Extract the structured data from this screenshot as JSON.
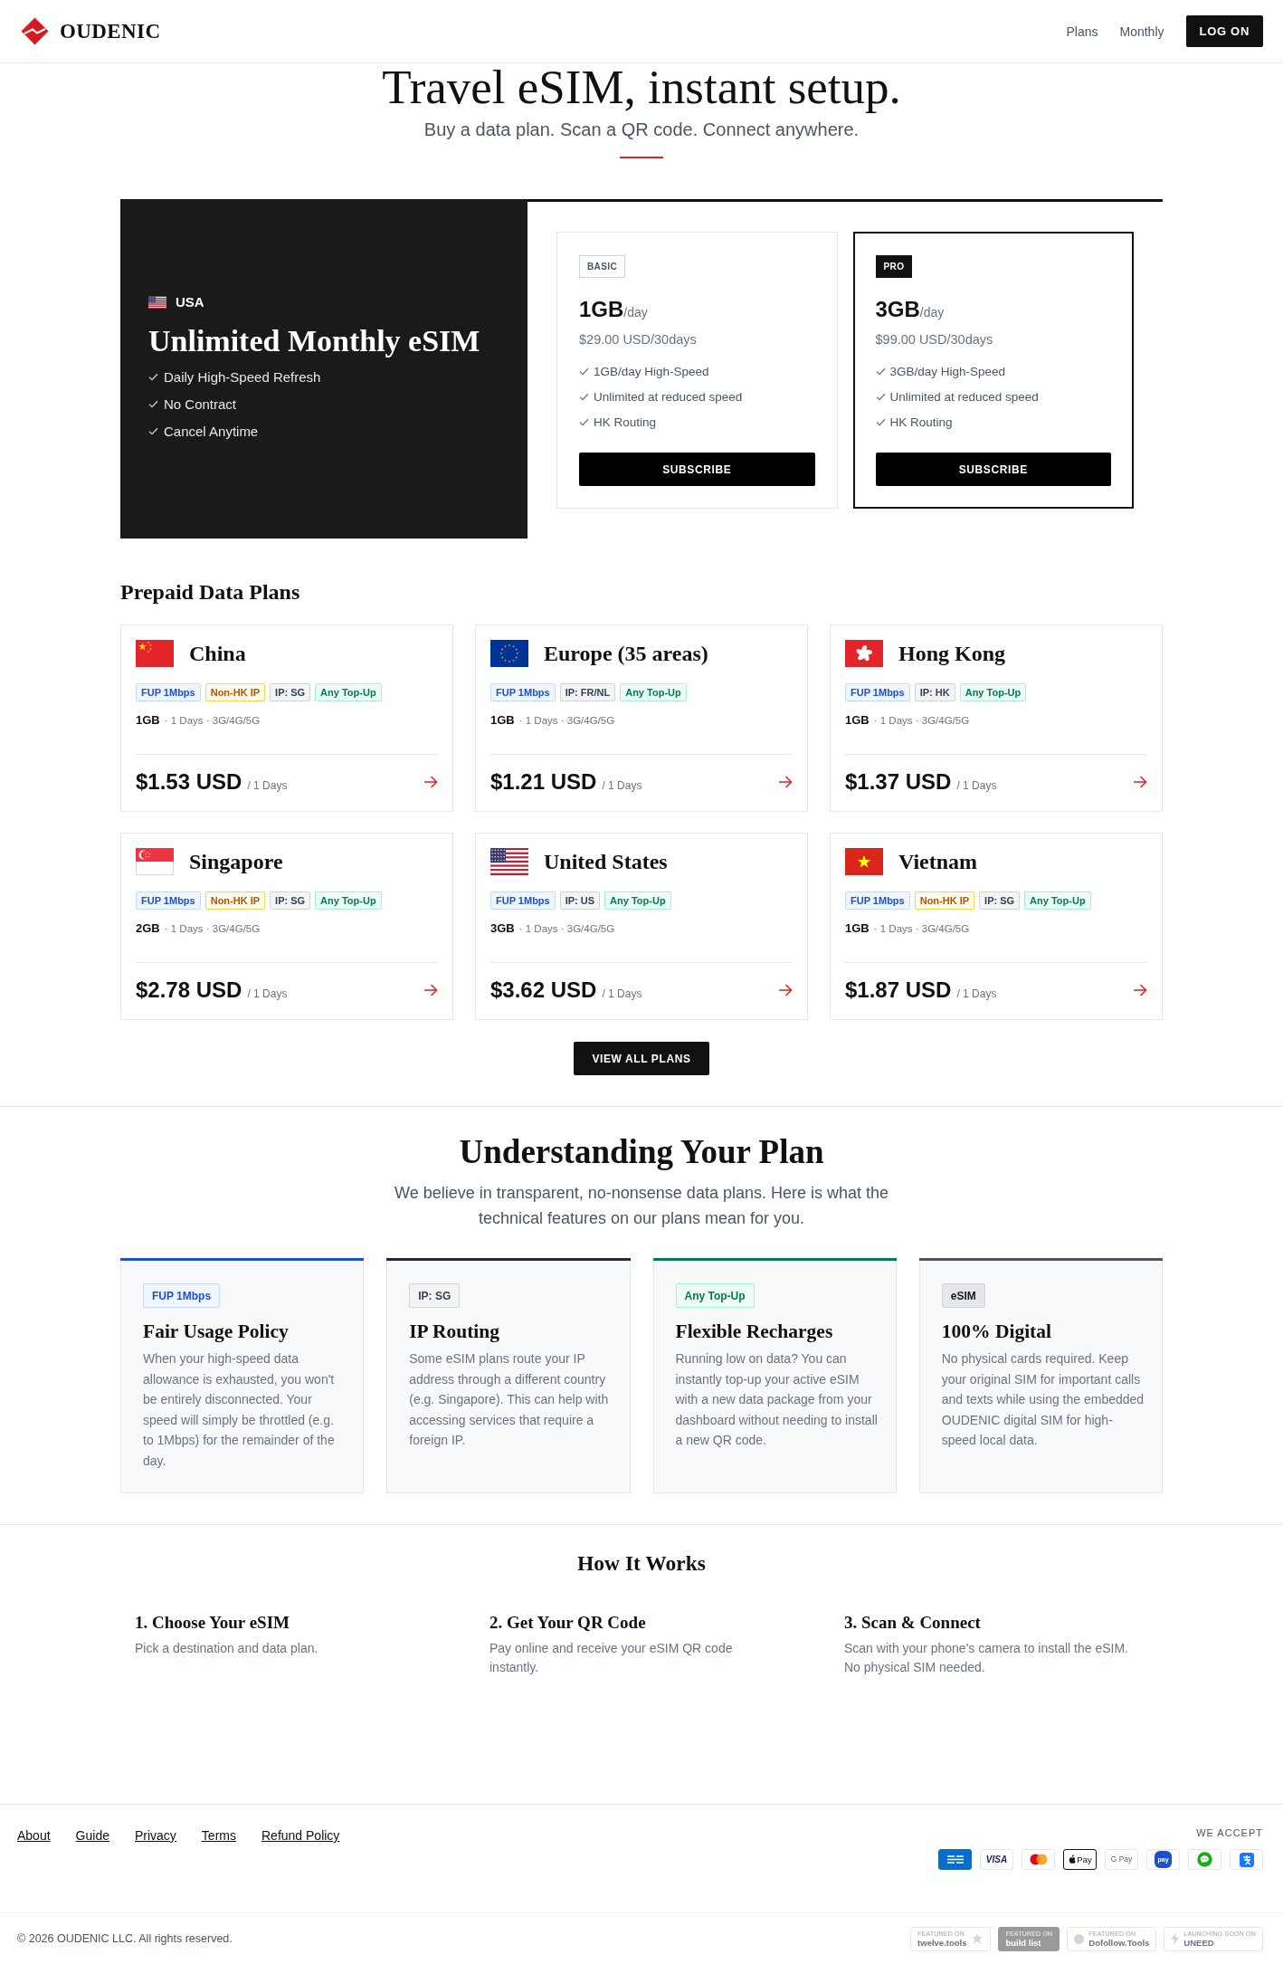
{
  "header": {
    "brand": "OUDENIC",
    "nav": [
      {
        "label": "Plans"
      },
      {
        "label": "Monthly"
      }
    ],
    "login": "LOG ON"
  },
  "hero": {
    "title": "Travel eSIM, instant setup.",
    "subtitle": "Buy a data plan. Scan a QR code. Connect anywhere."
  },
  "monthly": {
    "country": {
      "kind": "us",
      "name": "USA"
    },
    "title": "Unlimited Monthly eSIM",
    "perks": [
      "Daily High-Speed Refresh",
      "No Contract",
      "Cancel Anytime"
    ],
    "plans": [
      {
        "badge": "BASIC",
        "featured": false,
        "amount": "1GB",
        "unit": "/day",
        "price": "$29.00 USD/30days",
        "features": [
          "1GB/day High-Speed",
          "Unlimited at reduced speed",
          "HK Routing"
        ],
        "button": "SUBSCRIBE"
      },
      {
        "badge": "PRO",
        "featured": true,
        "amount": "3GB",
        "unit": "/day",
        "price": "$99.00 USD/30days",
        "features": [
          "3GB/day High-Speed",
          "Unlimited at reduced speed",
          "HK Routing"
        ],
        "button": "SUBSCRIBE"
      }
    ]
  },
  "prepaid": {
    "title": "Prepaid Data Plans",
    "plans": [
      {
        "kind": "cn",
        "name": "China",
        "tags": [
          {
            "kind": "speed",
            "label": "FUP 1Mbps"
          },
          {
            "kind": "region",
            "label": "Non-HK IP"
          },
          {
            "kind": "ip",
            "label": "IP: SG"
          },
          {
            "kind": "topup",
            "label": "Any Top-Up"
          }
        ],
        "data": "1GB",
        "meta": "· 1 Days · 3G/4G/5G",
        "price": "$1.53 USD",
        "period": "/ 1 Days"
      },
      {
        "kind": "eu",
        "name": "Europe (35 areas)",
        "tags": [
          {
            "kind": "speed",
            "label": "FUP 1Mbps"
          },
          {
            "kind": "ip",
            "label": "IP: FR/NL"
          },
          {
            "kind": "topup",
            "label": "Any Top-Up"
          }
        ],
        "data": "1GB",
        "meta": "· 1 Days · 3G/4G/5G",
        "price": "$1.21 USD",
        "period": "/ 1 Days"
      },
      {
        "kind": "hk",
        "name": "Hong Kong",
        "tags": [
          {
            "kind": "speed",
            "label": "FUP 1Mbps"
          },
          {
            "kind": "ip",
            "label": "IP: HK"
          },
          {
            "kind": "topup",
            "label": "Any Top-Up"
          }
        ],
        "data": "1GB",
        "meta": "· 1 Days · 3G/4G/5G",
        "price": "$1.37 USD",
        "period": "/ 1 Days"
      },
      {
        "kind": "sg",
        "name": "Singapore",
        "tags": [
          {
            "kind": "speed",
            "label": "FUP 1Mbps"
          },
          {
            "kind": "region",
            "label": "Non-HK IP"
          },
          {
            "kind": "ip",
            "label": "IP: SG"
          },
          {
            "kind": "topup",
            "label": "Any Top-Up"
          }
        ],
        "data": "2GB",
        "meta": "· 1 Days · 3G/4G/5G",
        "price": "$2.78 USD",
        "period": "/ 1 Days"
      },
      {
        "kind": "us",
        "name": "United States",
        "tags": [
          {
            "kind": "speed",
            "label": "FUP 1Mbps"
          },
          {
            "kind": "ip",
            "label": "IP: US"
          },
          {
            "kind": "topup",
            "label": "Any Top-Up"
          }
        ],
        "data": "3GB",
        "meta": "· 1 Days · 3G/4G/5G",
        "price": "$3.62 USD",
        "period": "/ 1 Days"
      },
      {
        "kind": "vn",
        "name": "Vietnam",
        "tags": [
          {
            "kind": "speed",
            "label": "FUP 1Mbps"
          },
          {
            "kind": "region",
            "label": "Non-HK IP"
          },
          {
            "kind": "ip",
            "label": "IP: SG"
          },
          {
            "kind": "topup",
            "label": "Any Top-Up"
          }
        ],
        "data": "1GB",
        "meta": "· 1 Days · 3G/4G/5G",
        "price": "$1.87 USD",
        "period": "/ 1 Days"
      }
    ],
    "button": "VIEW ALL PLANS"
  },
  "understanding": {
    "title": "Understanding Your Plan",
    "subtitle": "We believe in transparent, no-nonsense data plans. Here is what the technical features on our plans mean for you.",
    "cards": [
      {
        "color": "#1d4ed8",
        "tag": {
          "kind": "speed",
          "label": "FUP 1Mbps"
        },
        "title": "Fair Usage Policy",
        "text": "When your high-speed data allowance is exhausted, you won't be entirely disconnected. Your speed will simply be throttled (e.g. to 1Mbps) for the remainder of the day."
      },
      {
        "color": "#1f2937",
        "tag": {
          "kind": "ip",
          "label": "IP: SG"
        },
        "title": "IP Routing",
        "text": "Some eSIM plans route your IP address through a different country (e.g. Singapore). This can help with accessing services that require a foreign IP."
      },
      {
        "color": "#047857",
        "tag": {
          "kind": "topup",
          "label": "Any Top-Up"
        },
        "title": "Flexible Recharges",
        "text": "Running low on data? You can instantly top-up your active eSIM with a new data package from your dashboard without needing to install a new QR code."
      },
      {
        "color": "#4b5563",
        "tag": {
          "kind": "esim",
          "label": "eSIM"
        },
        "title": "100% Digital",
        "text": "No physical cards required. Keep your original SIM for important calls and texts while using the embedded OUDENIC digital SIM for high-speed local data."
      }
    ]
  },
  "how": {
    "title": "How It Works",
    "steps": [
      {
        "title": "1. Choose Your eSIM",
        "text": "Pick a destination and data plan."
      },
      {
        "title": "2. Get Your QR Code",
        "text": "Pay online and receive your eSIM QR code instantly."
      },
      {
        "title": "3. Scan & Connect",
        "text": "Scan with your phone's camera to install the eSIM. No physical SIM needed."
      }
    ]
  },
  "footer": {
    "links": [
      "About",
      "Guide",
      "Privacy",
      "Terms",
      "Refund Policy"
    ],
    "accept_label": "WE ACCEPT",
    "payments": [
      {
        "kind": "amex"
      },
      {
        "kind": "visa",
        "label": "VISA"
      },
      {
        "kind": "mastercard"
      },
      {
        "kind": "applepay",
        "label": "Pay"
      },
      {
        "kind": "googlepay",
        "label": "G Pay"
      },
      {
        "kind": "pay",
        "label": "pay"
      },
      {
        "kind": "wechat"
      },
      {
        "kind": "alipay"
      }
    ],
    "copyright": "© 2026 OUDENIC LLC. All rights reserved.",
    "badges": [
      {
        "kind": "twelve",
        "caption": "FEATURED ON",
        "title": "twelve.tools"
      },
      {
        "kind": "buildlist",
        "caption": "FEATURED ON",
        "title": "build list"
      },
      {
        "kind": "dofollow",
        "caption": "FEATURED ON",
        "title": "Dofollow.Tools"
      },
      {
        "kind": "uneed",
        "caption": "LAUNCHING SOON ON",
        "title": "UNEED"
      }
    ]
  }
}
